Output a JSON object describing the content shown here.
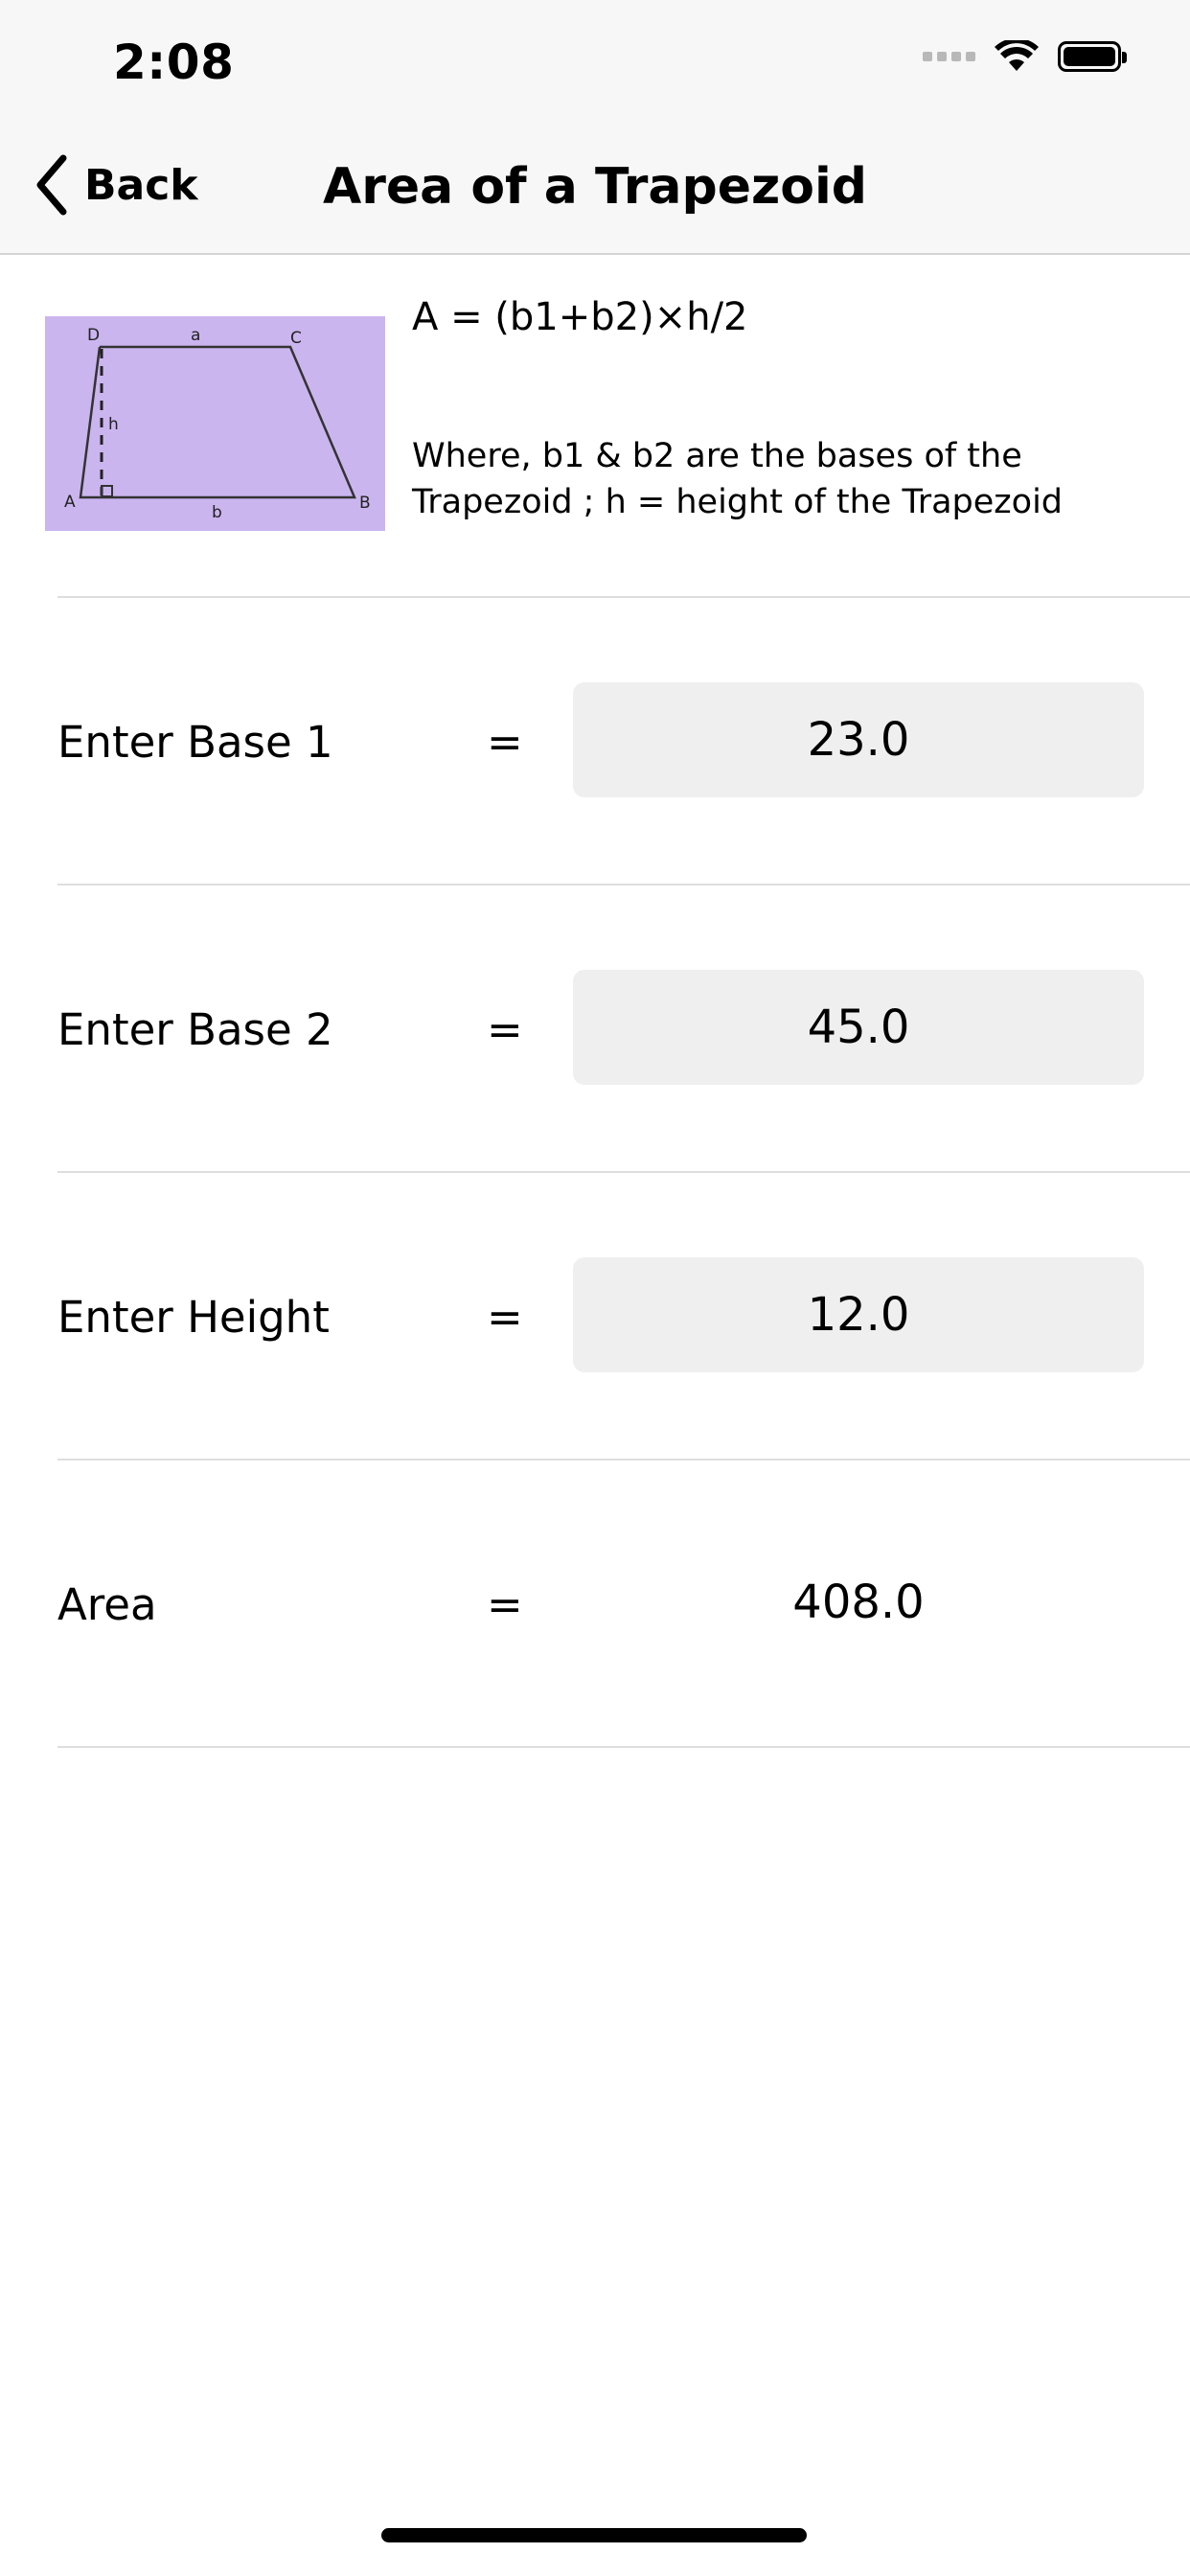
{
  "status_bar": {
    "time": "2:08"
  },
  "nav": {
    "back_label": "Back",
    "title": "Area of a Trapezoid"
  },
  "formula": {
    "equation": "A = (b1+b2)×h/2",
    "description": "Where, b1 & b2 are the bases of the Trapezoid ; h = height of the Trapezoid",
    "diagram": {
      "background": "#cbb5ef",
      "labels": {
        "a": "a",
        "b": "b",
        "h": "h",
        "A": "A",
        "B": "B",
        "C": "C",
        "D": "D"
      }
    }
  },
  "rows": [
    {
      "label": "Enter Base 1",
      "equals": "=",
      "value": "23.0"
    },
    {
      "label": "Enter Base 2",
      "equals": "=",
      "value": "45.0"
    },
    {
      "label": "Enter Height",
      "equals": "=",
      "value": "12.0"
    }
  ],
  "result": {
    "label": "Area",
    "equals": "=",
    "value": "408.0"
  },
  "colors": {
    "nav_background": "#f7f7f7",
    "input_background": "#efefef",
    "diagram_background": "#cbb5ef"
  }
}
